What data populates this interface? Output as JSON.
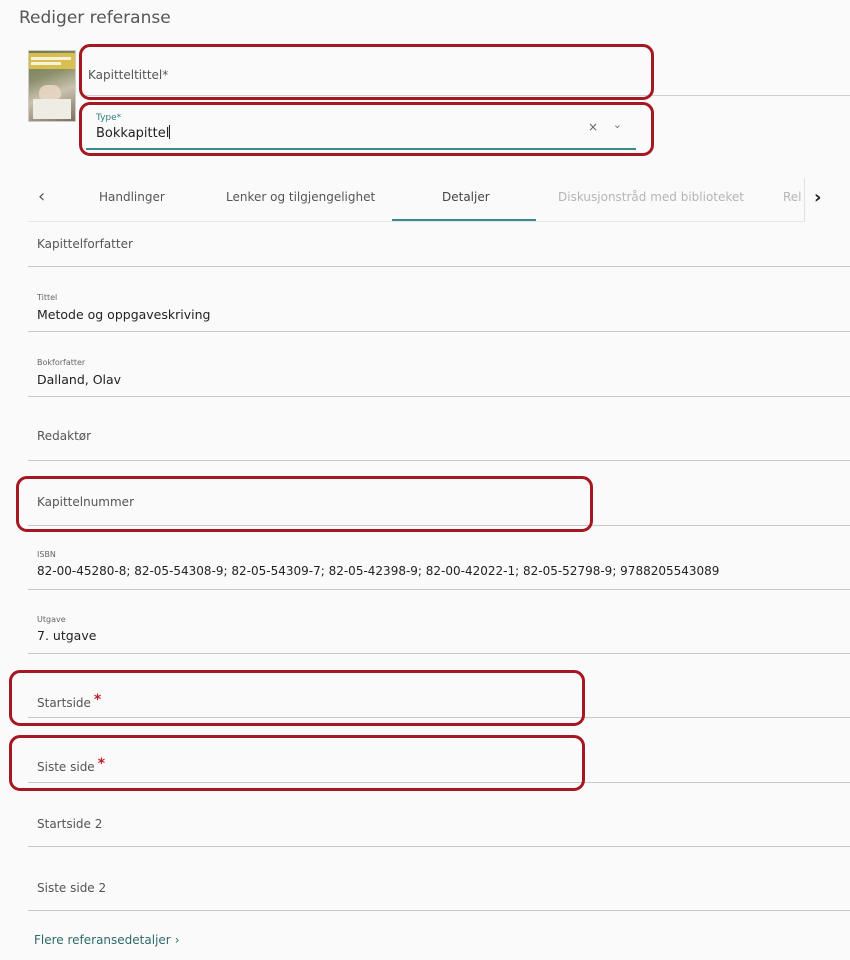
{
  "page": {
    "title": "Rediger referanse"
  },
  "chapter_title": {
    "placeholder": "Kapitteltittel",
    "required_mark": "*"
  },
  "type_field": {
    "label": "Type*",
    "value": "Bokkapittel",
    "clear_icon": "×",
    "dropdown_icon": "⌄"
  },
  "tabs": {
    "prev_icon": "‹",
    "next_icon": "›",
    "items": [
      {
        "label": "Handlinger"
      },
      {
        "label": "Lenker og tilgjengelighet"
      },
      {
        "label": "Detaljer",
        "active": true
      },
      {
        "label": "Diskusjonstråd med biblioteket",
        "disabled": true
      },
      {
        "label": "Rel"
      }
    ]
  },
  "details": {
    "chapter_author": {
      "placeholder": "Kapittelforfatter"
    },
    "title": {
      "label": "Tittel",
      "value": "Metode og oppgaveskriving"
    },
    "book_author": {
      "label": "Bokforfatter",
      "value": "Dalland, Olav"
    },
    "editor": {
      "placeholder": "Redaktør"
    },
    "chapter_number": {
      "placeholder": "Kapittelnummer"
    },
    "isbn": {
      "label": "ISBN",
      "value": "82-00-45280-8; 82-05-54308-9; 82-05-54309-7; 82-05-42398-9; 82-00-42022-1; 82-05-52798-9; 9788205543089"
    },
    "edition": {
      "label": "Utgave",
      "value": "7. utgave"
    },
    "start_page": {
      "placeholder": "Startside",
      "required_mark": "*"
    },
    "last_page": {
      "placeholder": "Siste side",
      "required_mark": "*"
    },
    "start_page_2": {
      "placeholder": "Startside 2"
    },
    "last_page_2": {
      "placeholder": "Siste side 2"
    }
  },
  "more_details": {
    "label": "Flere referansedetaljer",
    "icon": "›"
  },
  "colors": {
    "accent": "#3a8a8a",
    "highlight": "#a61821",
    "required": "#c0202a"
  }
}
